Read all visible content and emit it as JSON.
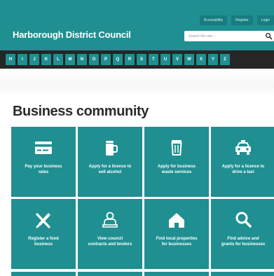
{
  "header": {
    "top_links": [
      "Accessibility",
      "Register",
      "Login"
    ],
    "title": "Harborough District Council",
    "search_placeholder": "Search this site..."
  },
  "az_letters": [
    "H",
    "I",
    "J",
    "K",
    "L",
    "M",
    "N",
    "O",
    "P",
    "Q",
    "R",
    "S",
    "T",
    "U",
    "V",
    "W",
    "X",
    "Y",
    "Z"
  ],
  "main": {
    "title": "Business community",
    "tiles": [
      {
        "label": "Pay your business\nrates",
        "icon": "credit-card-icon"
      },
      {
        "label": "Apply for a licence to\nsell alcohol",
        "icon": "beer-mug-icon"
      },
      {
        "label": "Apply for business\nwaste services",
        "icon": "waste-bin-icon"
      },
      {
        "label": "Apply for a licence to\ndrive a taxi",
        "icon": "taxi-icon"
      },
      {
        "label": "Register a food\nbusiness",
        "icon": "cutlery-icon"
      },
      {
        "label": "View council\ncontracts and tenders",
        "icon": "contract-signing-icon"
      },
      {
        "label": "Find local properties\nfor businesses",
        "icon": "house-icon"
      },
      {
        "label": "Find advice and\ngrants for businesses",
        "icon": "magnifier-icon"
      }
    ]
  },
  "colors": {
    "brand_teal": "#1f8f91",
    "az_bar": "#262626",
    "title_text": "#2b2b2b"
  }
}
